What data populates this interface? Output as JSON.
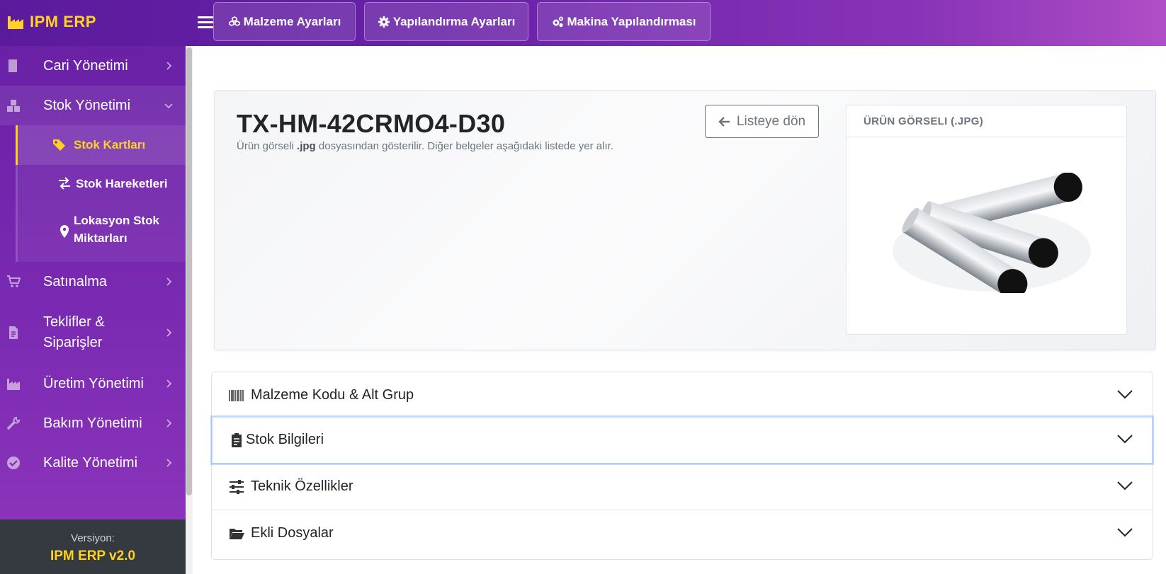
{
  "app": {
    "brand": "IPM ERP"
  },
  "topbar": {
    "buttons": [
      {
        "label": "Malzeme Ayarları",
        "icon": "cubes-icon"
      },
      {
        "label": "Yapılandırma Ayarları",
        "icon": "gear-icon"
      },
      {
        "label": "Makina Yapılandırması",
        "icon": "gears-icon"
      }
    ]
  },
  "sidebar": {
    "items": [
      {
        "label": "Cari Yönetimi",
        "icon": "building-icon"
      },
      {
        "label": "Stok Yönetimi",
        "icon": "boxes-icon",
        "expanded": true
      },
      {
        "label": "Satınalma",
        "icon": "cart-icon"
      },
      {
        "label": "Teklifler &",
        "label2": "Siparişler",
        "icon": "invoice-icon"
      },
      {
        "label": "Üretim Yönetimi",
        "icon": "industry-icon"
      },
      {
        "label": "Bakım Yönetimi",
        "icon": "tools-icon"
      },
      {
        "label": "Kalite Yönetimi",
        "icon": "check-circle-icon"
      }
    ],
    "submenu": [
      {
        "label": "Stok Kartları",
        "icon": "tags-icon",
        "active": true
      },
      {
        "label": "Stok Hareketleri",
        "icon": "exchange-icon"
      },
      {
        "label": "Lokasyon Stok",
        "label2": "Miktarları",
        "icon": "map-pin-icon"
      }
    ],
    "version_label": "Versiyon:",
    "version_value": "IPM ERP v2.0"
  },
  "product": {
    "code": "TX-HM-42CRMO4-D30",
    "desc_prefix": "Ürün görseli ",
    "desc_bold": ".jpg",
    "desc_suffix": " dosyasından gösterilir. Diğer belgeler aşağıdaki listede yer alır.",
    "back_label": "Listeye dön",
    "image_header": "ÜRÜN GÖRSELI (.JPG)"
  },
  "accordion": [
    {
      "label": "Malzeme Kodu & Alt Grup",
      "icon": "barcode-icon"
    },
    {
      "label": "Stok Bilgileri",
      "icon": "clipboard-icon",
      "focused": true
    },
    {
      "label": "Teknik Özellikler",
      "icon": "sliders-icon"
    },
    {
      "label": "Ekli Dosyalar",
      "icon": "folder-open-icon"
    }
  ],
  "colors": {
    "accent": "#ffd21f",
    "sidebar": "#6a21a6",
    "topbar_end": "#b04ec6"
  }
}
